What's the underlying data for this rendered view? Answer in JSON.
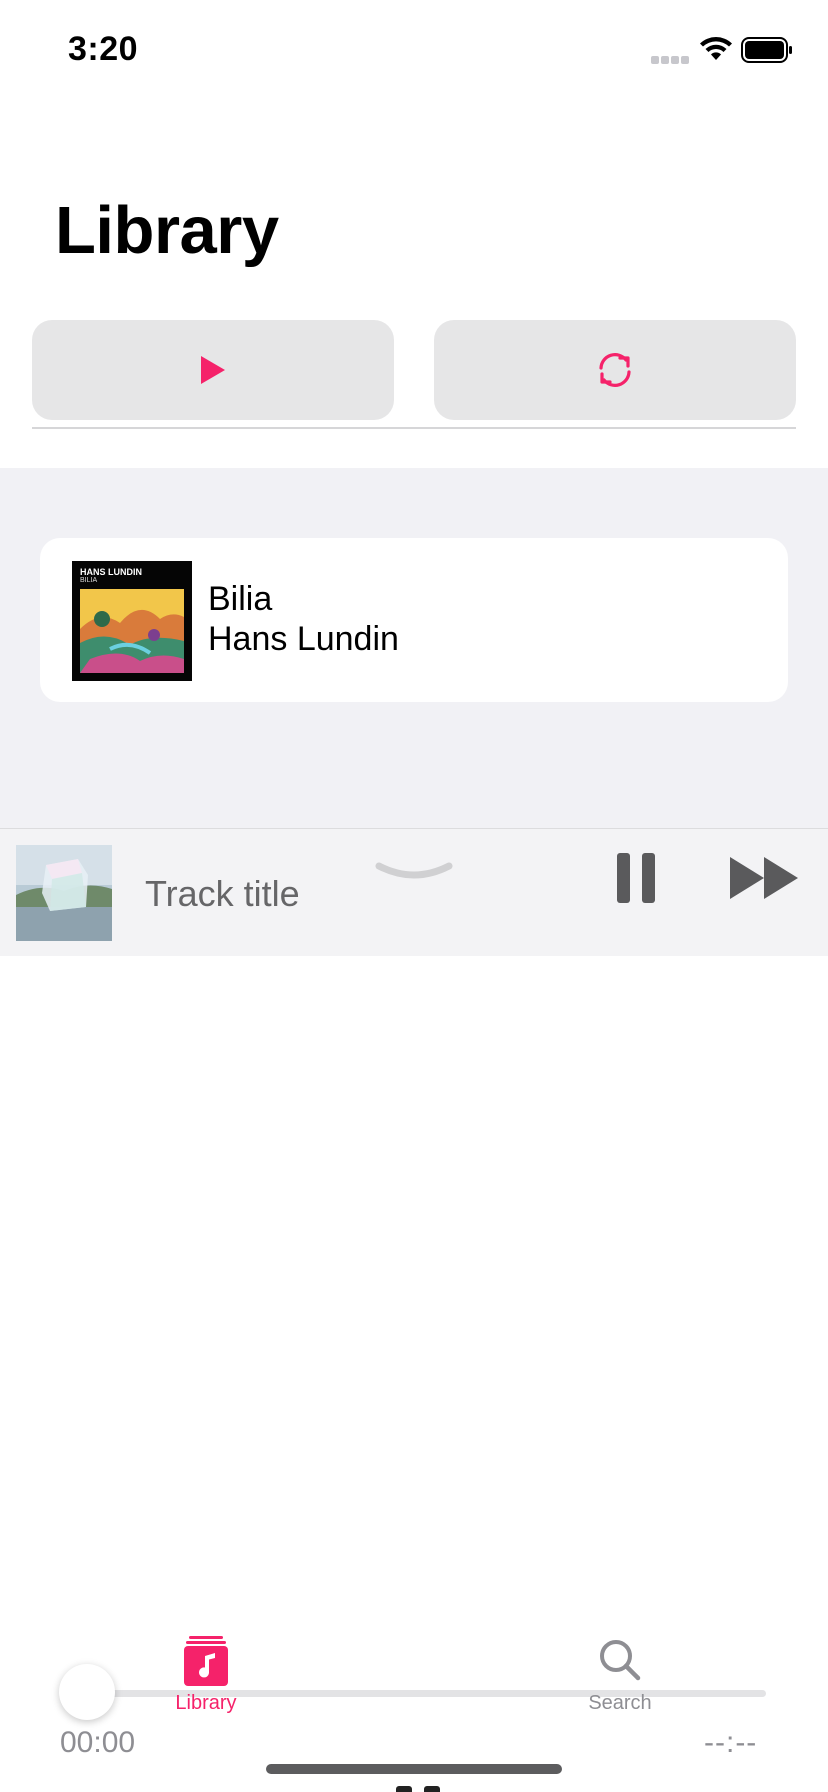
{
  "status_bar": {
    "time": "3:20",
    "signal_icon": "cellular-signal-icon",
    "wifi_icon": "wifi-icon",
    "battery_icon": "battery-icon"
  },
  "header": {
    "title": "Library"
  },
  "actions": {
    "play_icon": "play-icon",
    "shuffle_icon": "repeat-icon",
    "accent_color": "#f5226a"
  },
  "albums": [
    {
      "title": "Bilia",
      "artist": "Hans Lundin",
      "art_text_top": "HANS LUNDIN",
      "art_text_sub": "BILIA"
    }
  ],
  "mini_player": {
    "track_title": "Track title",
    "collapse_icon": "chevron-down-icon",
    "pause_icon": "pause-icon",
    "forward_icon": "fast-forward-icon"
  },
  "progress": {
    "elapsed": "00:00",
    "remaining": "--:--",
    "fraction": 0
  },
  "tab_bar": {
    "tabs": [
      {
        "label": "Library",
        "icon": "music-library-icon",
        "selected": true
      },
      {
        "label": "Search",
        "icon": "search-icon",
        "selected": false
      }
    ]
  }
}
